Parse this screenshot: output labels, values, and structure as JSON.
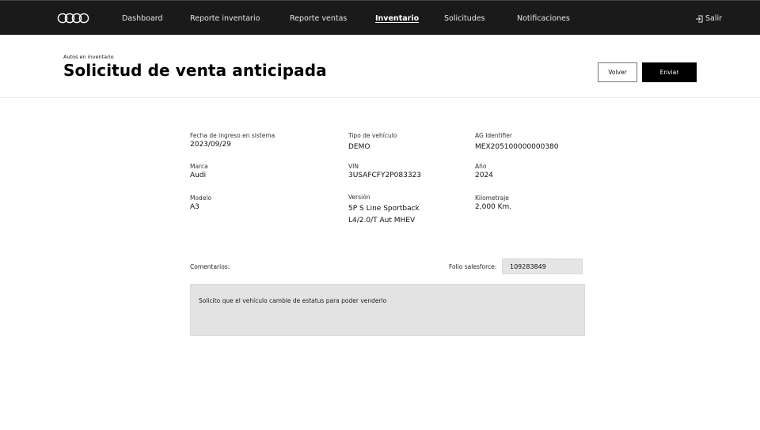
{
  "nav": {
    "items": [
      {
        "label": "Dashboard"
      },
      {
        "label": "Reporte inventario"
      },
      {
        "label": "Reporte ventas"
      },
      {
        "label": "Inventario",
        "active": true
      },
      {
        "label": "Solicitudes"
      },
      {
        "label": "Notificaciones"
      }
    ],
    "logout_label": "Salir",
    "logo_icon": "audi-rings-icon",
    "logout_icon": "logout-icon"
  },
  "header": {
    "breadcrumb": "Autos en inventario",
    "title": "Solicitud de venta anticipada",
    "back_label": "Volver",
    "send_label": "Enviar"
  },
  "details": {
    "fecha_label": "Fecha de ingreso en sistema",
    "fecha_value": "2023/09/29",
    "tipo_label": "Tipo de vehículo",
    "tipo_value": "DEMO",
    "ag_label": "AG Identifier",
    "ag_value": "MEX205100000000380",
    "marca_label": "Marca",
    "marca_value": "Audi",
    "vin_label": "VIN",
    "vin_value": "3USAFCFY2P083323",
    "anio_label": "Año",
    "anio_value": "2024",
    "modelo_label": "Modelo",
    "modelo_value": "A3",
    "version_label": "Versión",
    "version_value_line1": "5P S Line Sportback",
    "version_value_line2": "L4/2.0/T Aut MHEV",
    "km_label": "Kilometraje",
    "km_value": "2,000 Km."
  },
  "form": {
    "comments_label": "Comentarios:",
    "folio_label": "Folio salesforce:",
    "folio_value": "109283849",
    "comments_value": "Solicito que el vehículo cambie de estatus para poder venderlo"
  },
  "colors": {
    "nav_bg": "#1a1a1a",
    "primary_button": "#000000",
    "input_bg": "#e5e5e5"
  }
}
